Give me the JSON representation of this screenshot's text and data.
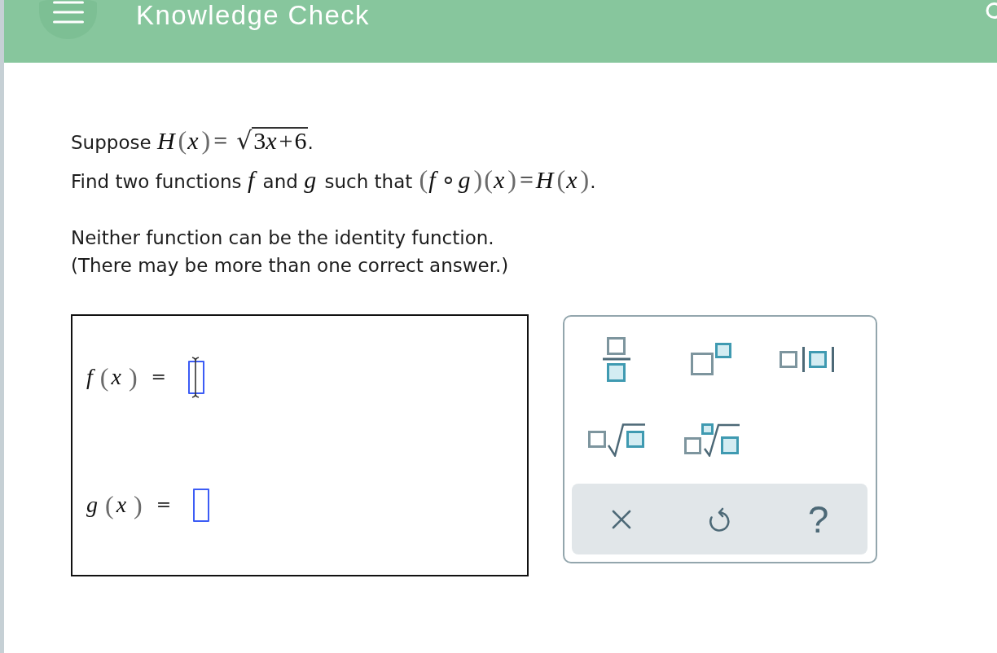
{
  "header": {
    "title": "Knowledge Check"
  },
  "question": {
    "lines": [
      [
        {
          "kind": "text",
          "s": "Suppose "
        },
        {
          "kind": "var",
          "s": "H"
        },
        {
          "kind": "delim",
          "s": "("
        },
        {
          "kind": "var",
          "s": "x"
        },
        {
          "kind": "delim",
          "s": ")"
        },
        {
          "kind": "op",
          "s": "="
        },
        {
          "kind": "sqrt",
          "sign": "√",
          "radicand": [
            {
              "kind": "num",
              "s": "3"
            },
            {
              "kind": "var",
              "s": "x"
            },
            {
              "kind": "op",
              "s": "+"
            },
            {
              "kind": "num",
              "s": "6"
            }
          ]
        },
        {
          "kind": "text",
          "s": "."
        }
      ],
      [
        {
          "kind": "text",
          "s": "Find two functions "
        },
        {
          "kind": "var",
          "s": "f"
        },
        {
          "kind": "text",
          "s": " and "
        },
        {
          "kind": "var",
          "s": "g"
        },
        {
          "kind": "text",
          "s": " such that "
        },
        {
          "kind": "delim",
          "s": "("
        },
        {
          "kind": "var",
          "s": "f"
        },
        {
          "kind": "op",
          "s": "∘"
        },
        {
          "kind": "var",
          "s": "g"
        },
        {
          "kind": "delim",
          "s": ")"
        },
        {
          "kind": "delim",
          "s": "("
        },
        {
          "kind": "var",
          "s": "x"
        },
        {
          "kind": "delim",
          "s": ")"
        },
        {
          "kind": "op",
          "s": "="
        },
        {
          "kind": "var",
          "s": "H"
        },
        {
          "kind": "delim",
          "s": "("
        },
        {
          "kind": "var",
          "s": "x"
        },
        {
          "kind": "delim",
          "s": ")"
        },
        {
          "kind": "text",
          "s": "."
        }
      ]
    ],
    "notes": [
      "Neither function can be the identity function.",
      "(There may be more than one correct answer.)"
    ]
  },
  "answers": [
    {
      "label": [
        {
          "kind": "var",
          "s": "f"
        },
        {
          "kind": "delim",
          "s": "("
        },
        {
          "kind": "var",
          "s": "x"
        },
        {
          "kind": "delim",
          "s": ")"
        },
        {
          "kind": "op",
          "s": "="
        }
      ],
      "focused": true
    },
    {
      "label": [
        {
          "kind": "var",
          "s": "g"
        },
        {
          "kind": "delim",
          "s": "("
        },
        {
          "kind": "var",
          "s": "x"
        },
        {
          "kind": "delim",
          "s": ")"
        },
        {
          "kind": "op",
          "s": "="
        }
      ],
      "focused": false
    }
  ],
  "keypad": {
    "keys": [
      {
        "kind": "fraction"
      },
      {
        "kind": "superscript"
      },
      {
        "kind": "absolute_value"
      },
      {
        "kind": "square_root"
      },
      {
        "kind": "nth_root"
      }
    ],
    "actions": [
      {
        "kind": "clear"
      },
      {
        "kind": "undo"
      },
      {
        "kind": "help",
        "label": "?"
      }
    ]
  }
}
